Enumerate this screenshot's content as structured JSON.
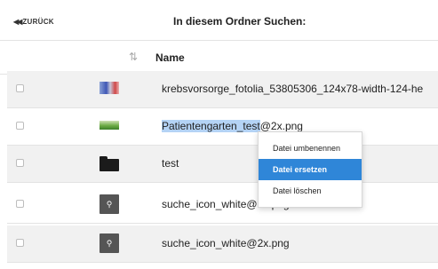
{
  "topbar": {
    "back_label": "ZURÜCK",
    "back_icon": "double-chevron-left-icon",
    "title": "In diesem Ordner Suchen:"
  },
  "header": {
    "sort_icon": "sort-arrows-icon",
    "name_label": "Name"
  },
  "rows": [
    {
      "name": "krebsvorsorge_fotolia_53805306_124x78-width-124-he",
      "thumb": "image-thumbnail"
    },
    {
      "name_selected": "Patientengarten_test",
      "name_rest": "@2x.png",
      "thumb": "image-thumbnail"
    },
    {
      "name": "test",
      "thumb": "folder-icon"
    },
    {
      "name": "suche_icon_white@1x.png",
      "thumb": "search-icon"
    },
    {
      "name": "suche_icon_white@2x.png",
      "thumb": "search-icon"
    }
  ],
  "context_menu": {
    "items": [
      "Datei umbenennen",
      "Datei ersetzen",
      "Datei löschen"
    ],
    "active_index": 1
  },
  "colors": {
    "menu_highlight": "#2f86d8",
    "text_selection": "#b4d3f5",
    "row_shade": "#f1f1f1"
  }
}
